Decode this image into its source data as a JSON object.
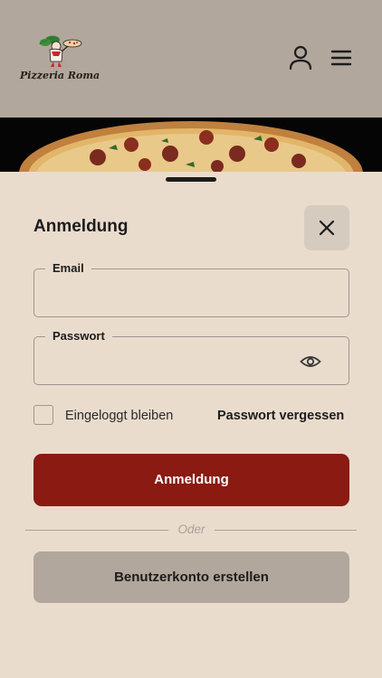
{
  "header": {
    "logo_text": "Pizzeria Roma",
    "user_icon": "user-icon",
    "menu_icon": "hamburger-menu-icon"
  },
  "login": {
    "title": "Anmeldung",
    "close_icon": "close-icon",
    "email": {
      "label": "Email",
      "value": ""
    },
    "password": {
      "label": "Passwort",
      "value": "",
      "toggle_icon": "eye-icon"
    },
    "remember_me": {
      "label": "Eingeloggt bleiben",
      "checked": false
    },
    "forgot_password": "Passwort vergessen",
    "submit_label": "Anmeldung",
    "divider_text": "Oder",
    "register_label": "Benutzerkonto erstellen"
  },
  "colors": {
    "header_bg": "#b2a79c",
    "sheet_bg": "#eadccd",
    "primary": "#8a1a12",
    "secondary_button": "#b2a79c"
  }
}
